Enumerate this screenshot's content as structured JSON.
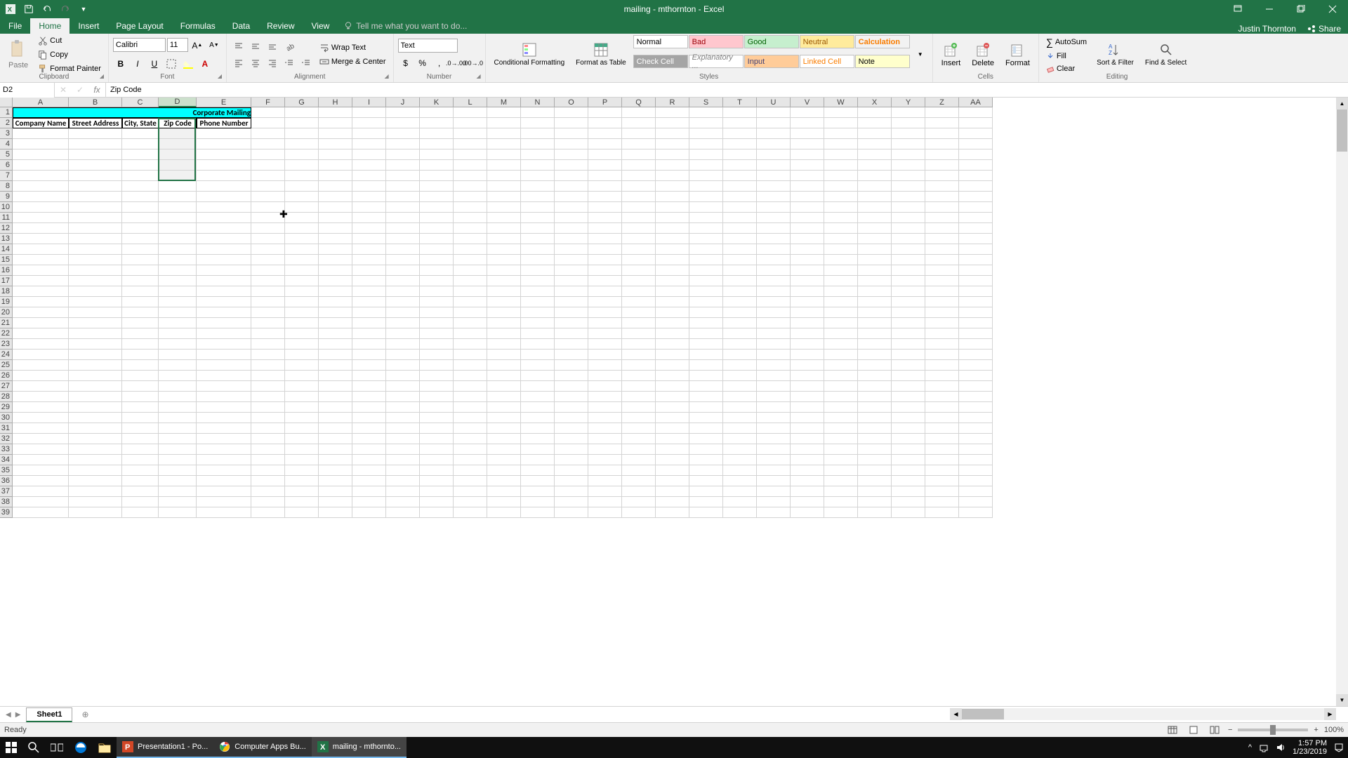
{
  "window": {
    "title": "mailing - mthornton - Excel"
  },
  "tabs": {
    "file": "File",
    "home": "Home",
    "insert": "Insert",
    "pageLayout": "Page Layout",
    "formulas": "Formulas",
    "data": "Data",
    "review": "Review",
    "view": "View",
    "tellMe": "Tell me what you want to do...",
    "user": "Justin Thornton",
    "share": "Share"
  },
  "ribbon": {
    "clipboard": {
      "paste": "Paste",
      "cut": "Cut",
      "copy": "Copy",
      "formatPainter": "Format Painter",
      "label": "Clipboard"
    },
    "font": {
      "name": "Calibri",
      "size": "11",
      "label": "Font"
    },
    "alignment": {
      "wrapText": "Wrap Text",
      "mergeCenter": "Merge & Center",
      "label": "Alignment"
    },
    "number": {
      "format": "Text",
      "label": "Number"
    },
    "styles": {
      "conditional": "Conditional Formatting",
      "formatTable": "Format as Table",
      "normal": "Normal",
      "bad": "Bad",
      "good": "Good",
      "neutral": "Neutral",
      "calculation": "Calculation",
      "checkCell": "Check Cell",
      "explanatory": "Explanatory ...",
      "input": "Input",
      "linkedCell": "Linked Cell",
      "note": "Note",
      "label": "Styles"
    },
    "cells": {
      "insert": "Insert",
      "delete": "Delete",
      "format": "Format",
      "label": "Cells"
    },
    "editing": {
      "autoSum": "AutoSum",
      "fill": "Fill",
      "clear": "Clear",
      "sortFilter": "Sort & Filter",
      "findSelect": "Find & Select",
      "label": "Editing"
    }
  },
  "formulaBar": {
    "nameBox": "D2",
    "formula": "Zip Code"
  },
  "columns": [
    "A",
    "B",
    "C",
    "D",
    "E",
    "F",
    "G",
    "H",
    "I",
    "J",
    "K",
    "L",
    "M",
    "N",
    "O",
    "P",
    "Q",
    "R",
    "S",
    "T",
    "U",
    "V",
    "W",
    "X",
    "Y",
    "Z",
    "AA"
  ],
  "sheet": {
    "titleRow": "Corporate Mailing",
    "headers": [
      "Company Name",
      "Street Address",
      "City, State",
      "Zip Code",
      "Phone Number"
    ]
  },
  "sheetTabs": {
    "sheet1": "Sheet1"
  },
  "statusBar": {
    "ready": "Ready",
    "zoom": "100%"
  },
  "taskbar": {
    "ppt": "Presentation1 - Po...",
    "chrome": "Computer Apps Bu...",
    "excel": "mailing - mthornto...",
    "time": "1:57 PM",
    "date": "1/23/2019"
  }
}
